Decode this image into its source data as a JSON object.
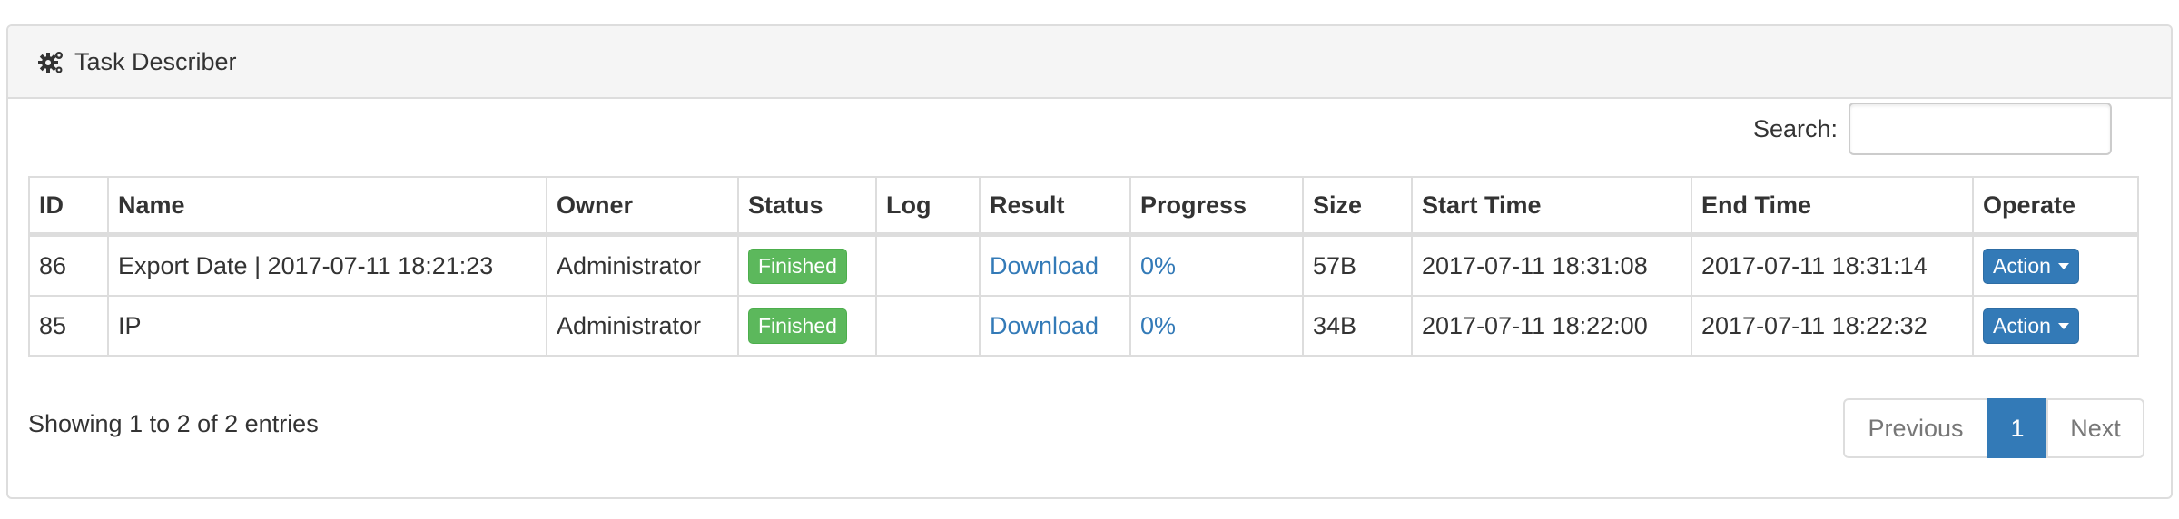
{
  "panel": {
    "title": "Task Describer",
    "icon": "gears-icon"
  },
  "search": {
    "label": "Search:",
    "value": "",
    "placeholder": ""
  },
  "table": {
    "headers": [
      "ID",
      "Name",
      "Owner",
      "Status",
      "Log",
      "Result",
      "Progress",
      "Size",
      "Start Time",
      "End Time",
      "Operate"
    ],
    "rows": [
      {
        "id": "86",
        "name": "Export Date | 2017-07-11 18:21:23",
        "owner": "Administrator",
        "status": "Finished",
        "log": "",
        "result": "Download",
        "progress": "0%",
        "size": "57B",
        "start_time": "2017-07-11 18:31:08",
        "end_time": "2017-07-11 18:31:14",
        "operate": "Action"
      },
      {
        "id": "85",
        "name": "IP",
        "owner": "Administrator",
        "status": "Finished",
        "log": "",
        "result": "Download",
        "progress": "0%",
        "size": "34B",
        "start_time": "2017-07-11 18:22:00",
        "end_time": "2017-07-11 18:22:32",
        "operate": "Action"
      }
    ]
  },
  "footer": {
    "info": "Showing 1 to 2 of 2 entries",
    "pagination": {
      "previous": "Previous",
      "current": "1",
      "next": "Next"
    }
  },
  "colors": {
    "status_success": "#5cb85c",
    "primary": "#337ab7",
    "border": "#dddddd",
    "heading_bg": "#f5f5f5"
  }
}
